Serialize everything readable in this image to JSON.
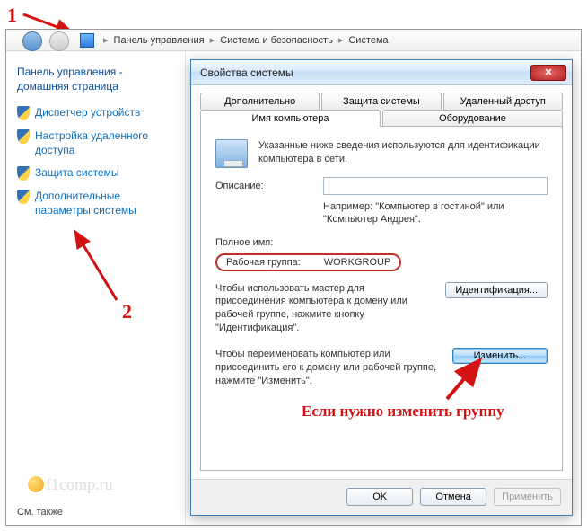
{
  "annotations": {
    "n1": "1",
    "n2": "2",
    "note": "Если нужно изменить группу"
  },
  "breadcrumb": {
    "items": [
      "Панель управления",
      "Система и безопасность",
      "Система"
    ]
  },
  "sidebar": {
    "title": "Панель управления - домашняя страница",
    "links": [
      "Диспетчер устройств",
      "Настройка удаленного доступа",
      "Защита системы",
      "Дополнительные параметры системы"
    ],
    "see_also": "См. также",
    "watermark": "f1comp.ru"
  },
  "dialog": {
    "title": "Свойства системы",
    "tabs_top": [
      "Дополнительно",
      "Защита системы",
      "Удаленный доступ"
    ],
    "tabs_bottom": [
      "Имя компьютера",
      "Оборудование"
    ],
    "info": "Указанные ниже сведения используются для идентификации компьютера в сети.",
    "desc_label": "Описание:",
    "desc_value": "",
    "example": "Например: \"Компьютер в гостиной\" или \"Компьютер Андрея\".",
    "fullname_label": "Полное имя:",
    "fullname_value": "",
    "workgroup_label": "Рабочая группа:",
    "workgroup_value": "WORKGROUP",
    "para_id": "Чтобы использовать мастер для присоединения компьютера к домену или рабочей группе, нажмите кнопку \"Идентификация\".",
    "btn_id": "Идентификация...",
    "para_change": "Чтобы переименовать компьютер или присоединить его к домену или рабочей группе, нажмите \"Изменить\".",
    "btn_change": "Изменить...",
    "buttons": {
      "ok": "OK",
      "cancel": "Отмена",
      "apply": "Применить"
    }
  }
}
